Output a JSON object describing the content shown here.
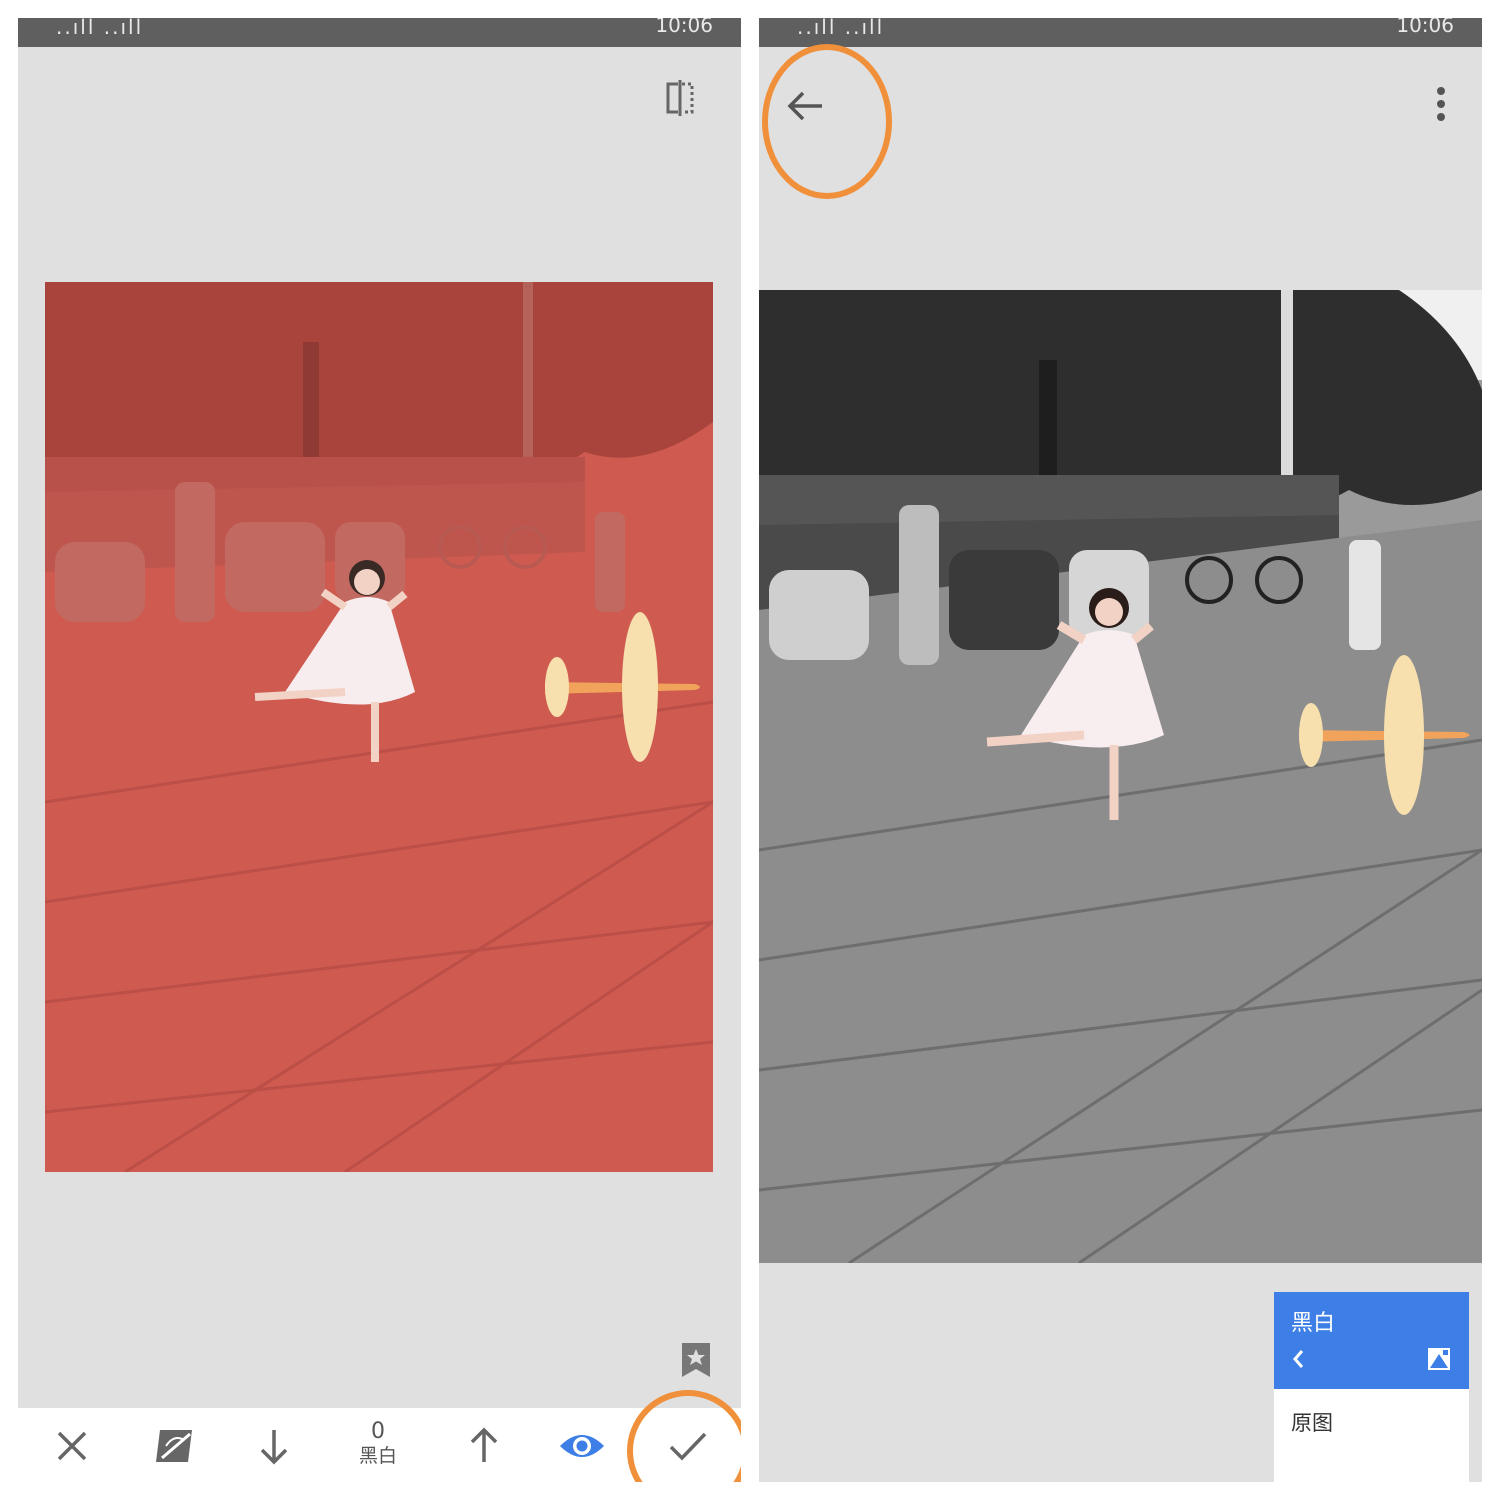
{
  "left_screen": {
    "status_bar": {
      "signal": "..ıll ..ıll",
      "time": "10:06"
    },
    "value_display": {
      "value": "0",
      "label": "黑白"
    },
    "overlay_color": "#d9544b",
    "icons": {
      "compare": "compare-split-icon",
      "bookmark": "bookmark-star-icon",
      "cancel": "close-icon",
      "mask": "mask-brush-icon",
      "decrease": "arrow-down-icon",
      "increase": "arrow-up-icon",
      "view": "eye-icon",
      "apply": "checkmark-icon"
    },
    "accent_color": "#3d7fe6"
  },
  "right_screen": {
    "status_bar": {
      "signal": "..ıll ..ıll",
      "time": "10:06"
    },
    "menu": {
      "title": "黑白",
      "item": "原图"
    },
    "icons": {
      "back": "arrow-left-icon",
      "more": "more-vertical-icon",
      "menu_back": "chevron-left-icon",
      "menu_stack": "stack-edit-icon"
    }
  },
  "highlight_color": "#f0903a"
}
